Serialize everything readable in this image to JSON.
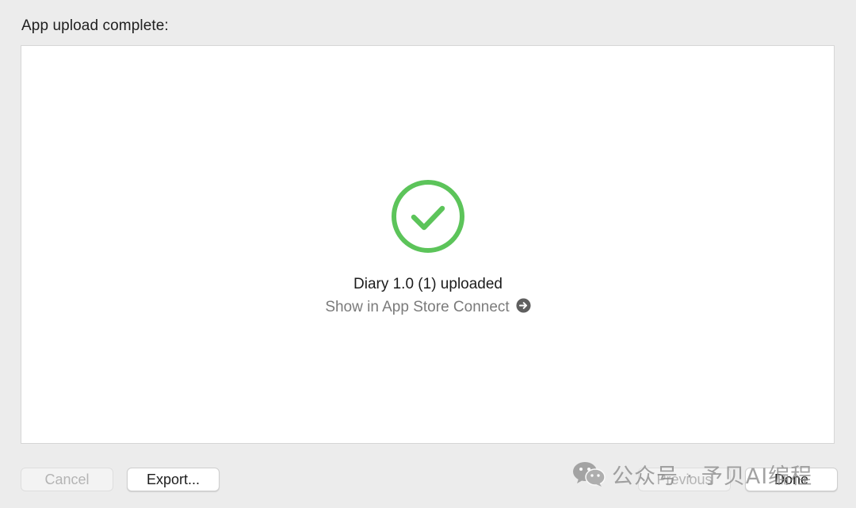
{
  "dialog": {
    "heading": "App upload complete:"
  },
  "result": {
    "icon": "checkmark-circle-icon",
    "status_color": "#5cc45a",
    "title": "Diary 1.0 (1) uploaded",
    "link_label": "Show in App Store Connect",
    "link_icon": "arrow-right-circle-icon"
  },
  "buttons": {
    "cancel": "Cancel",
    "export": "Export...",
    "previous": "Previous",
    "done": "Done"
  },
  "watermark": {
    "text": "公众号 · 予贝AI编程",
    "icon": "wechat-icon"
  }
}
